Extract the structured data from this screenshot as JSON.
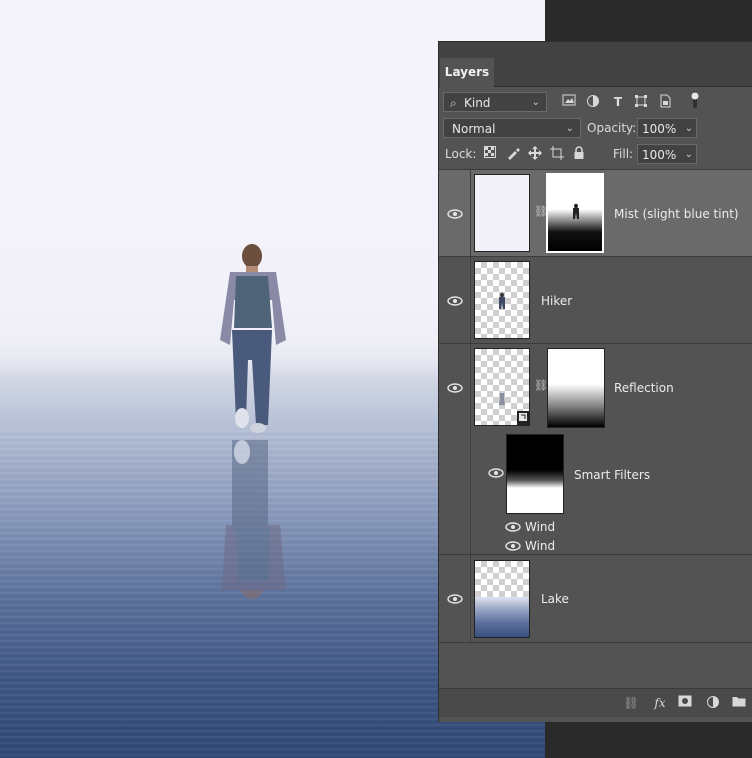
{
  "panel": {
    "tab_label": "Layers",
    "filter": {
      "value": "Kind"
    },
    "blend_mode": {
      "value": "Normal"
    },
    "opacity": {
      "label": "Opacity:",
      "value": "100%"
    },
    "lock_label": "Lock:",
    "fill": {
      "label": "Fill:",
      "value": "100%"
    }
  },
  "layers": [
    {
      "name": "Mist (slight blue tint)",
      "selected": true,
      "visible": true
    },
    {
      "name": "Hiker",
      "selected": false,
      "visible": true
    },
    {
      "name": "Reflection",
      "selected": false,
      "visible": true,
      "smart_filters": {
        "label": "Smart Filters",
        "items": [
          "Wind",
          "Wind"
        ]
      }
    },
    {
      "name": "Lake",
      "selected": false,
      "visible": true
    }
  ],
  "colors": {
    "panel_bg": "#535353",
    "selected_row": "#6a6a6a",
    "tab_bar": "#424242"
  }
}
